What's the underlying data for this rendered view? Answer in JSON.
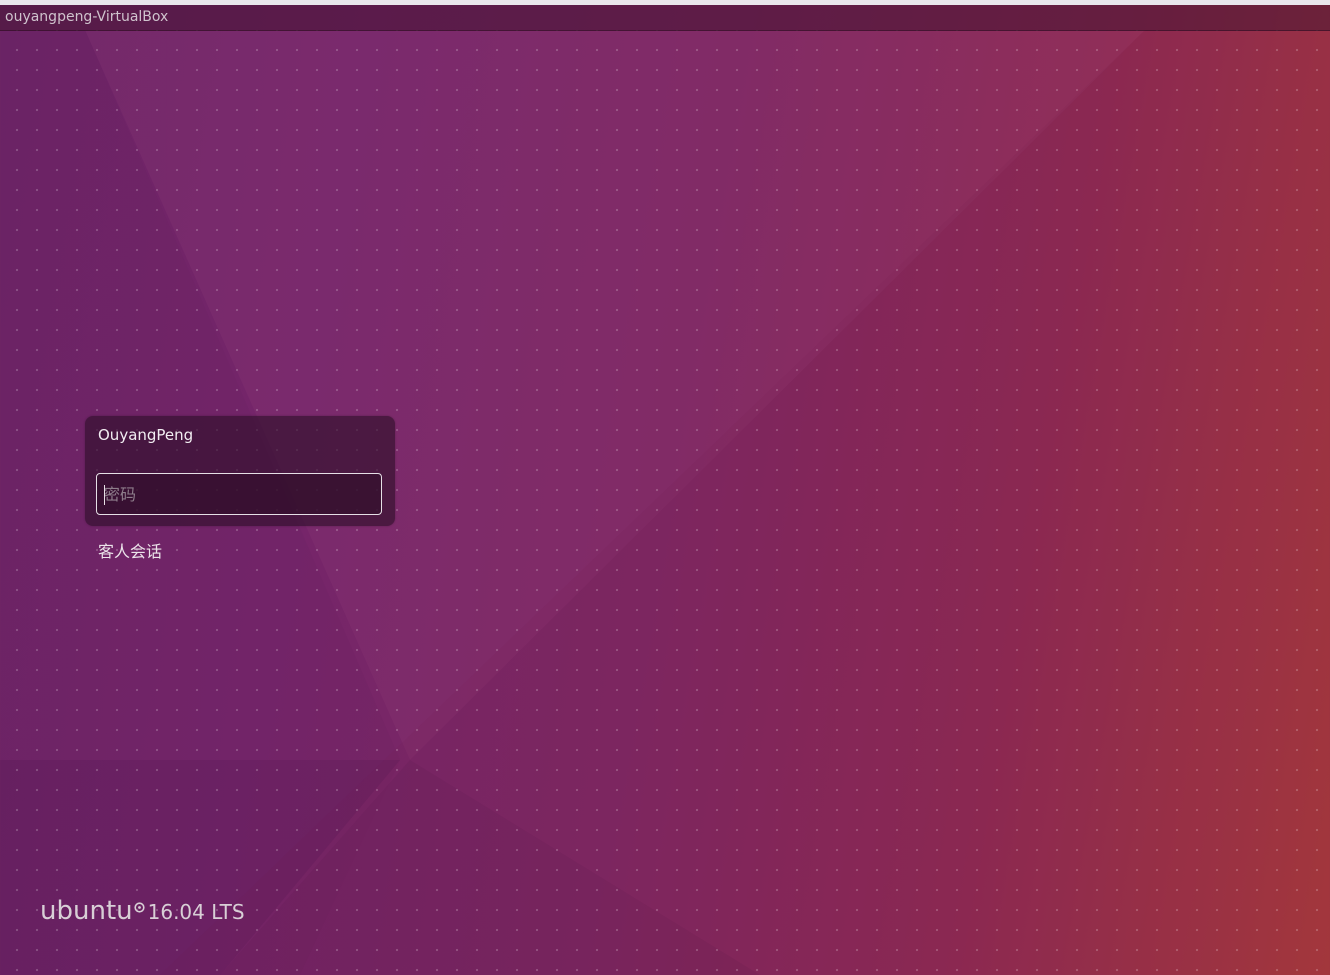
{
  "panel": {
    "hostname": "ouyangpeng-VirtualBox"
  },
  "login": {
    "user_name": "OuyangPeng",
    "password_placeholder": "密码",
    "password_value": ""
  },
  "guest": {
    "label": "客人会话"
  },
  "branding": {
    "logo_icon": "circle-of-friends-icon",
    "word": "ubuntu",
    "version": "16.04 LTS"
  },
  "colors": {
    "wallpaper_left": "#6c2466",
    "wallpaper_right": "#a83a3a",
    "panel_bg": "#4a1a3a",
    "text_light": "#f2eef2"
  }
}
